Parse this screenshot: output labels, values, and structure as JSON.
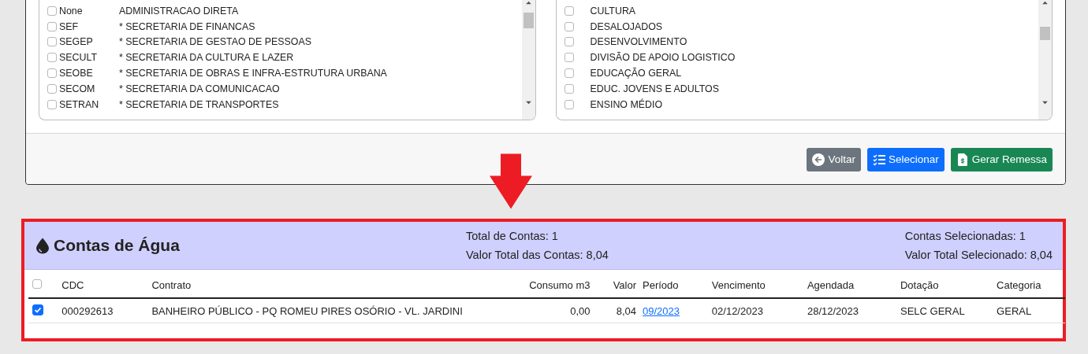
{
  "left_list": {
    "items": [
      {
        "code": "None",
        "name": "ADMINISTRACAO DIRETA",
        "checked": false
      },
      {
        "code": "SEF",
        "name": "* SECRETARIA DE FINANCAS",
        "checked": false
      },
      {
        "code": "SEGEP",
        "name": "* SECRETARIA DE GESTAO DE PESSOAS",
        "checked": false
      },
      {
        "code": "SECULT",
        "name": "* SECRETARIA DA CULTURA E LAZER",
        "checked": false
      },
      {
        "code": "SEOBE",
        "name": "* SECRETARIA DE OBRAS E INFRA-ESTRUTURA URBANA",
        "checked": false
      },
      {
        "code": "SECOM",
        "name": "* SECRETARIA DA COMUNICACAO",
        "checked": false
      },
      {
        "code": "SETRAN",
        "name": "* SECRETARIA DE TRANSPORTES",
        "checked": false
      }
    ]
  },
  "right_list": {
    "items": [
      {
        "name": "CULTURA",
        "checked": false
      },
      {
        "name": "DESALOJADOS",
        "checked": false
      },
      {
        "name": "DESENVOLVIMENTO",
        "checked": false
      },
      {
        "name": "DIVISÃO DE APOIO LOGISTICO",
        "checked": false
      },
      {
        "name": "EDUCAÇÃO GERAL",
        "checked": false
      },
      {
        "name": "EDUC. JOVENS E ADULTOS",
        "checked": false
      },
      {
        "name": "ENSINO MÉDIO",
        "checked": false
      }
    ]
  },
  "buttons": [
    {
      "kind": "back",
      "label": "Voltar"
    },
    {
      "kind": "select",
      "label": "Selecionar"
    },
    {
      "kind": "generate",
      "label": "Gerar Remessa"
    }
  ],
  "panel": {
    "title": "Contas de Água",
    "totals": [
      "Total de Contas: 1",
      "Valor Total das Contas: 8,04"
    ],
    "selected_totals": [
      "Contas Selecionadas: 1",
      "Valor Total Selecionado: 8,04"
    ]
  },
  "table": {
    "select_all": {
      "checked": false
    },
    "columns": [
      {
        "label": "CDC",
        "kind": "text"
      },
      {
        "label": "Contrato",
        "kind": "text"
      },
      {
        "label": "Consumo m3",
        "kind": "number"
      },
      {
        "label": "Valor",
        "kind": "number"
      },
      {
        "label": "Período",
        "kind": "link"
      },
      {
        "label": "Vencimento",
        "kind": "text"
      },
      {
        "label": "Agendada",
        "kind": "text"
      },
      {
        "label": "Dotação",
        "kind": "text"
      },
      {
        "label": "Categoria",
        "kind": "text"
      }
    ],
    "rows": [
      {
        "selected": true,
        "cells": [
          "000292613",
          "BANHEIRO PÚBLICO - PQ ROMEU PIRES OSÓRIO - VL. JARDINI",
          "0,00",
          "8,04",
          "09/2023",
          "02/12/2023",
          "28/12/2023",
          "SELC GERAL",
          "GERAL"
        ]
      }
    ]
  }
}
